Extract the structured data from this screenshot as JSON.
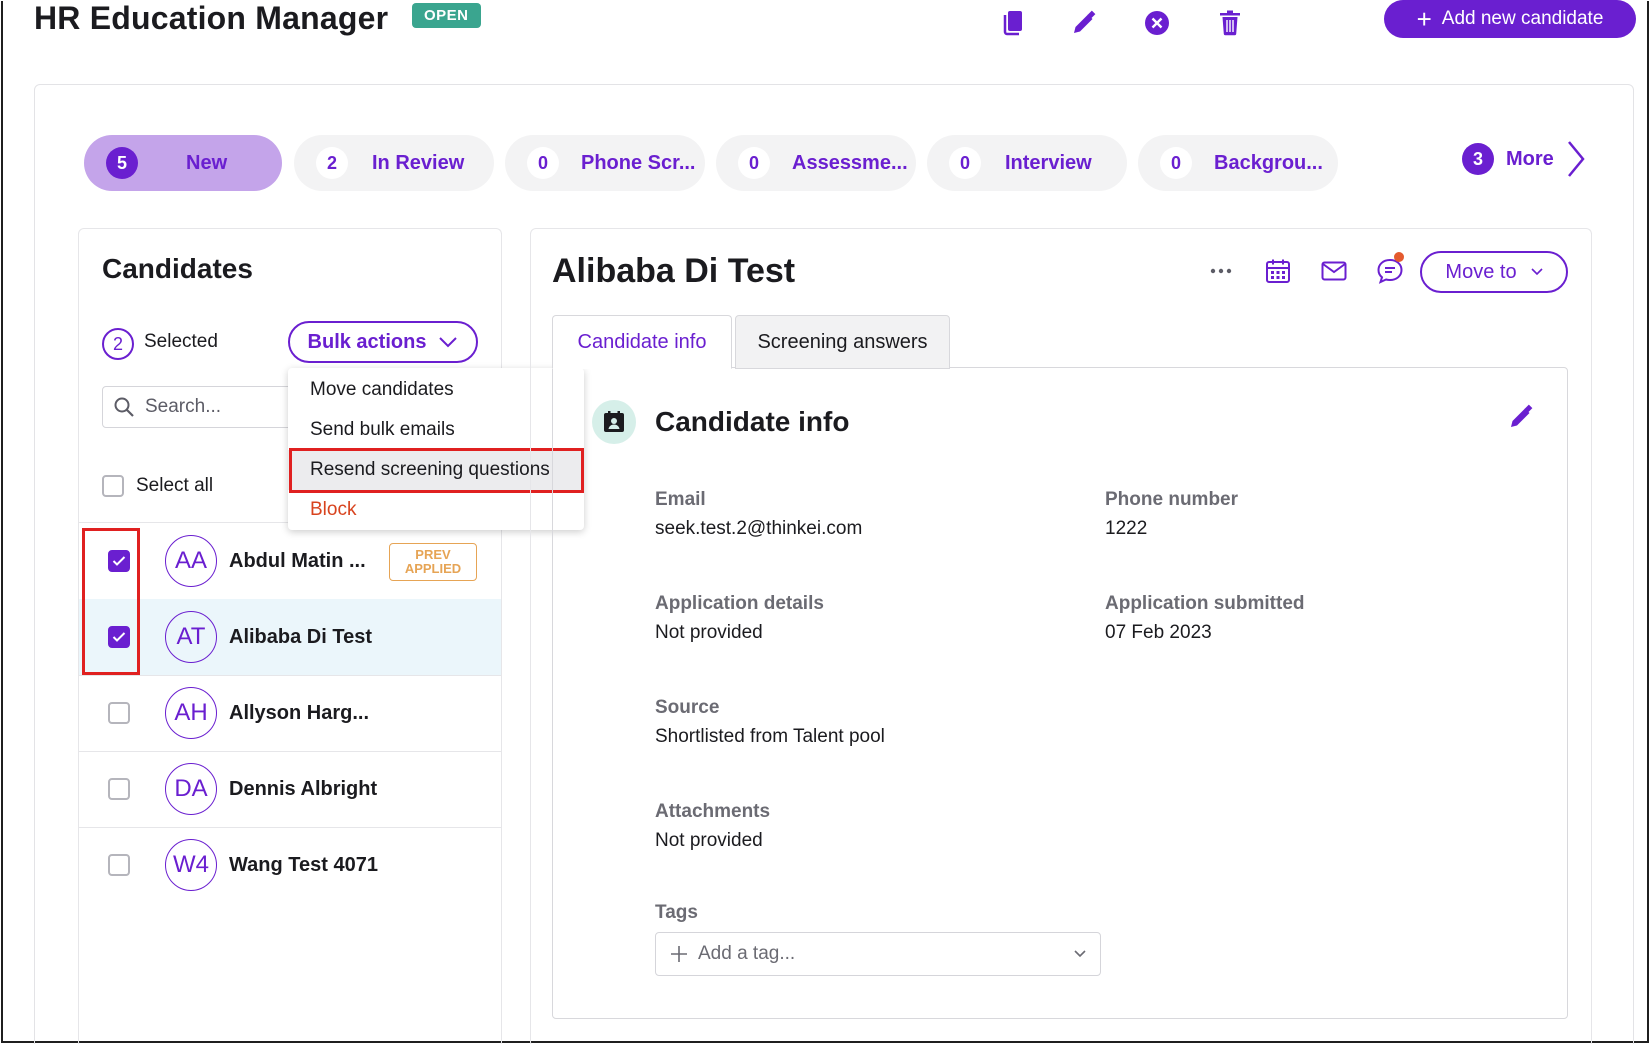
{
  "header": {
    "title": "HR Education Manager",
    "status": "OPEN",
    "add_label": "Add new candidate",
    "icons": [
      "copy-icon",
      "pencil-icon",
      "close-circle-icon",
      "trash-icon"
    ]
  },
  "stages": [
    {
      "count": "5",
      "label": "New",
      "active": true
    },
    {
      "count": "2",
      "label": "In Review"
    },
    {
      "count": "0",
      "label": "Phone Scr..."
    },
    {
      "count": "0",
      "label": "Assessme..."
    },
    {
      "count": "0",
      "label": "Interview"
    },
    {
      "count": "0",
      "label": "Backgrou..."
    }
  ],
  "more": {
    "count": "3",
    "label": "More"
  },
  "candidates_panel": {
    "title": "Candidates",
    "selected_count": "2",
    "selected_label": "Selected",
    "bulk_label": "Bulk actions",
    "search_placeholder": "Search...",
    "select_all_label": "Select all"
  },
  "bulk_menu": {
    "items": [
      {
        "label": "Move candidates"
      },
      {
        "label": "Send bulk emails"
      },
      {
        "label": "Resend screening questions",
        "highlighted": true
      },
      {
        "label": "Block",
        "danger": true
      }
    ]
  },
  "candidates": [
    {
      "initials": "AA",
      "name": "Abdul Matin ...",
      "checked": true,
      "badge_line1": "PREV",
      "badge_line2": "APPLIED"
    },
    {
      "initials": "AT",
      "name": "Alibaba Di Test",
      "checked": true,
      "selected": true
    },
    {
      "initials": "AH",
      "name": "Allyson Harg...",
      "checked": false
    },
    {
      "initials": "DA",
      "name": "Dennis Albright",
      "checked": false
    },
    {
      "initials": "W4",
      "name": "Wang Test 4071",
      "checked": false
    }
  ],
  "detail": {
    "name": "Alibaba Di Test",
    "move_label": "Move to",
    "tabs": [
      "Candidate info",
      "Screening answers"
    ],
    "section_title": "Candidate info",
    "fields": {
      "email_label": "Email",
      "email": "seek.test.2@thinkei.com",
      "phone_label": "Phone number",
      "phone": "1222",
      "app_details_label": "Application details",
      "app_details": "Not provided",
      "submitted_label": "Application submitted",
      "submitted": "07 Feb 2023",
      "source_label": "Source",
      "source": "Shortlisted from Talent pool",
      "attachments_label": "Attachments",
      "attachments": "Not provided",
      "tags_label": "Tags",
      "tags_placeholder": "Add a tag..."
    }
  },
  "colors": {
    "accent": "#6a1fd0",
    "open_badge": "#3aa58f",
    "highlight_box": "#e02020",
    "danger": "#d8431e",
    "prev_badge": "#e6a455"
  }
}
